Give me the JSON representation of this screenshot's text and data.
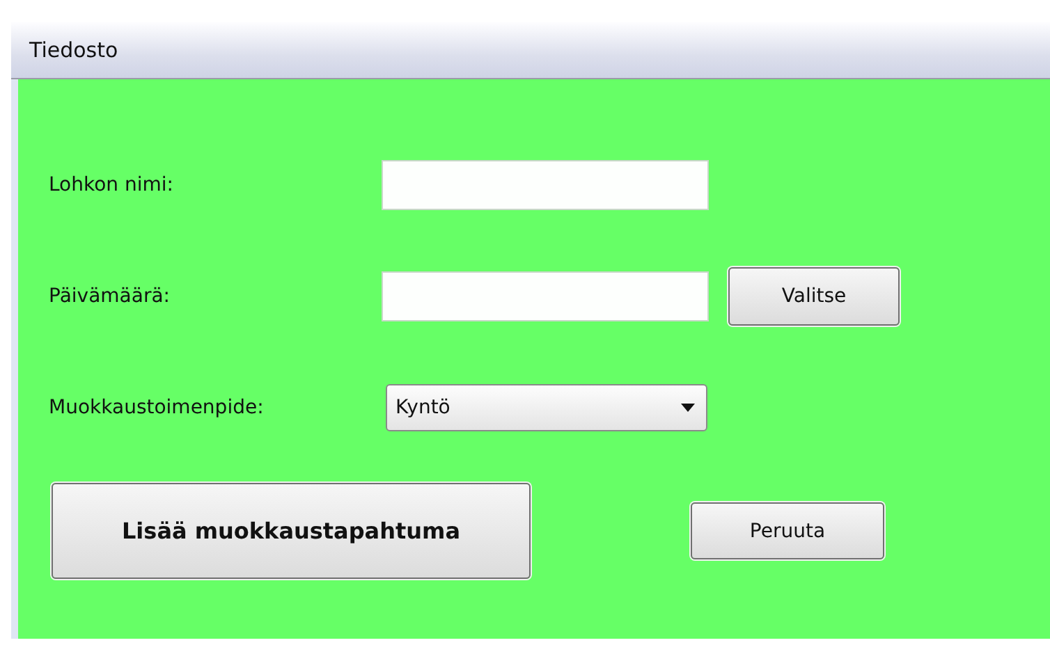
{
  "menu_bar": {
    "items": [
      "Tiedosto"
    ]
  },
  "form": {
    "rows": [
      {
        "kind": "text",
        "label": "Lohkon nimi:"
      },
      {
        "kind": "text_button",
        "label": "Päivämäärä:",
        "button": "Valitse"
      },
      {
        "kind": "dropdown",
        "label": "Muokkaustoimenpide:",
        "value": "Kyntö"
      }
    ]
  },
  "actions": [
    {
      "kind": "primary",
      "label": "Lisää muokkaustapahtuma"
    },
    {
      "kind": "secondary",
      "label": "Peruuta"
    }
  ]
}
